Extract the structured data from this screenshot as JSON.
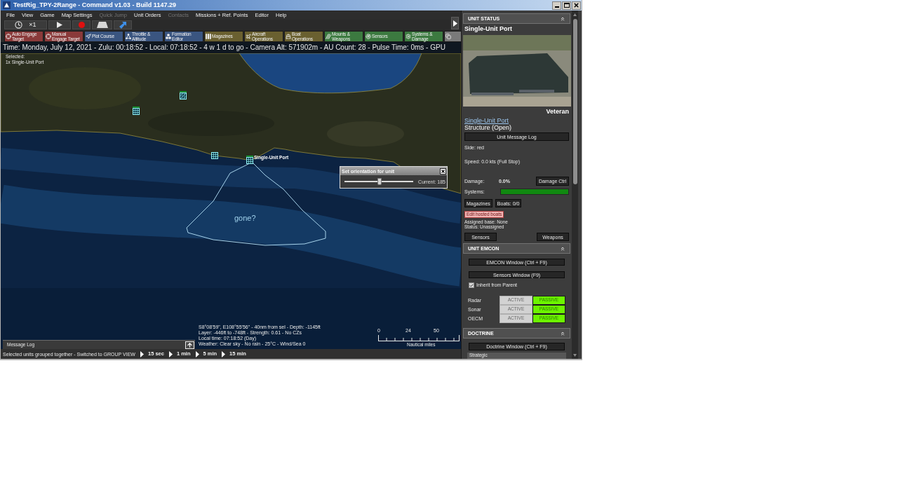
{
  "window": {
    "title": "TestRig_TPY-2Range - Command v1.03 - Build 1147.29"
  },
  "menu": [
    {
      "label": "File",
      "disabled": false
    },
    {
      "label": "View",
      "disabled": false
    },
    {
      "label": "Game",
      "disabled": false
    },
    {
      "label": "Map Settings",
      "disabled": false
    },
    {
      "label": "Quick Jump",
      "disabled": true
    },
    {
      "label": "Unit Orders",
      "disabled": false
    },
    {
      "label": "Contacts",
      "disabled": true
    },
    {
      "label": "Missions + Ref. Points",
      "disabled": false
    },
    {
      "label": "Editor",
      "disabled": false
    },
    {
      "label": "Help",
      "disabled": false
    }
  ],
  "time_controls": {
    "compression": "×1"
  },
  "order_buttons": [
    {
      "label": "Auto Engage\nTarget",
      "color": "#8a3a3a"
    },
    {
      "label": "Manual\nEngage Target",
      "color": "#8a3a3a"
    },
    {
      "label": "Plot Course",
      "color": "#3a5580"
    },
    {
      "label": "Throttle &\nAltitude",
      "color": "#3a5580"
    },
    {
      "label": "Formation\nEditor",
      "color": "#3a5580"
    },
    {
      "label": "Magazines",
      "color": "#6a6030"
    },
    {
      "label": "Aircraft\nOperations",
      "color": "#6a6030"
    },
    {
      "label": "Boat\nOperations",
      "color": "#6a6030"
    },
    {
      "label": "Mounts &\nWeapons",
      "color": "#3c7a40"
    },
    {
      "label": "Sensors",
      "color": "#3c7a40"
    },
    {
      "label": "Systems &\nDamage",
      "color": "#3c7a40"
    },
    {
      "color": "#7a7a7a"
    }
  ],
  "info_bar": "Time: Monday, July 12, 2021 - Zulu: 00:18:52 - Local: 07:18:52 - 4 w 1 d to go - Camera Alt: 571902m - AU Count: 28 - Pulse Time: 0ms - GPU",
  "map": {
    "selection_title": "Selected:",
    "selection": "1x Single-Unit Port",
    "unit_label": "Single-Unit Port",
    "note": "gone?",
    "cursor_info": [
      "S8°08'59\", E108°55'56\" - 40nm from sel - Depth: -1145ft",
      "Layer: -446ft to -748ft - Strength: 0.61 - No CZs",
      "Local time: 07:18:52 (Day)",
      "Weather: Clear sky - No rain - 25°C - Wind/Sea 0"
    ],
    "scale": {
      "ticks": [
        "0",
        "24",
        "50"
      ],
      "unit": "Nautical miles"
    },
    "message_log": "Message Log"
  },
  "dialog": {
    "title": "Set orientation for unit",
    "level": 0.51,
    "reading": "Current: 185"
  },
  "status_bar": {
    "message": "Selected units grouped together - Switched to GROUP VIEW",
    "steps": [
      "15 sec",
      "1 min",
      "5 min",
      "15 min"
    ]
  },
  "unit_status": {
    "header": "UNIT STATUS",
    "name": "Single-Unit Port",
    "rating": "Veteran",
    "link": "Single-Unit Port",
    "type": "Structure (Open)",
    "log_button": "Unit Message Log",
    "side": "Side: red",
    "speed": "Speed: 0.0 kts (Full Stop)",
    "damage": {
      "label": "Damage:",
      "value": "0.0%",
      "button": "Damage Ctrl"
    },
    "systems": {
      "label": "Systems:",
      "level": 1
    },
    "buttons": [
      "Magazines",
      "Boats: 0/0"
    ],
    "hosted_button": "Edit hosted boats",
    "assigned_base": "Assigned base: None",
    "status": "Status: Unassigned",
    "bottom_buttons": [
      "Sensors",
      "Weapons"
    ]
  },
  "emcon": {
    "header": "UNIT EMCON",
    "buttons": [
      "EMCON Window (Ctrl + F9)",
      "Sensors Window (F9)"
    ],
    "inherit": {
      "label": "Inherit from Parent",
      "checked": true
    },
    "rows": [
      {
        "name": "Radar",
        "options": [
          {
            "label": "ACTIVE",
            "selected": false
          },
          {
            "label": "PASSIVE",
            "selected": true
          }
        ]
      },
      {
        "name": "Sonar",
        "options": [
          {
            "label": "ACTIVE",
            "selected": false
          },
          {
            "label": "PASSIVE",
            "selected": true
          }
        ]
      },
      {
        "name": "OECM",
        "options": [
          {
            "label": "ACTIVE",
            "selected": false
          },
          {
            "label": "PASSIVE",
            "selected": true
          }
        ]
      }
    ]
  },
  "doctrine": {
    "header": "DOCTRINE",
    "button": "Doctrine Window (Ctrl + F9)",
    "next_item": "Strategic"
  }
}
